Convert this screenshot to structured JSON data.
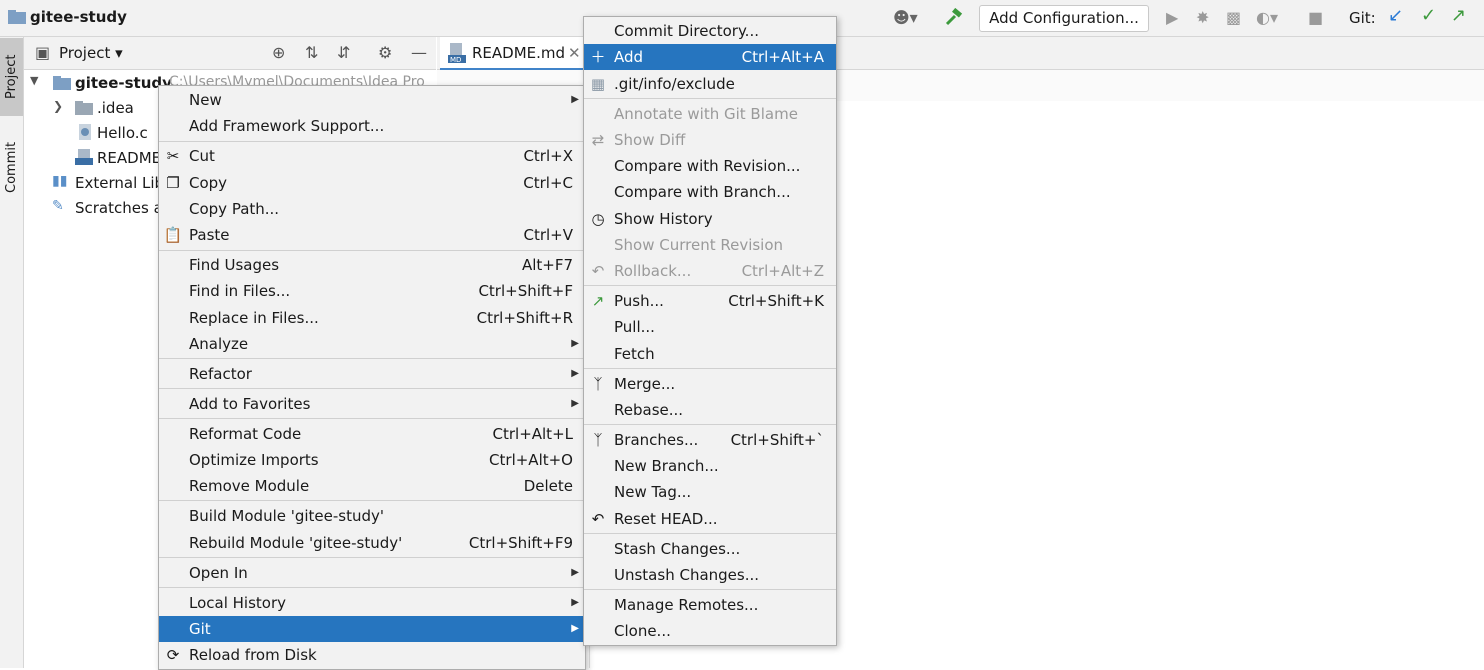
{
  "titlebar": {
    "project_name": "gitee-study",
    "git_label": "Git:",
    "add_configuration": "Add Configuration..."
  },
  "sidebar": {
    "project_tab": "Project",
    "commit_tab": "Commit"
  },
  "project_panel": {
    "header": "Project",
    "root": "gitee-study",
    "root_path": "C:\\Users\\Mymel\\Documents\\Idea Pro",
    "items": [
      ".idea",
      "Hello.c",
      "README",
      "External Lib",
      "Scratches a"
    ]
  },
  "editor": {
    "tab_label": "README.md"
  },
  "context_menu": {
    "items": [
      {
        "label": "New",
        "shortcut": "",
        "submenu": true
      },
      {
        "label": "Add Framework Support...",
        "shortcut": ""
      },
      {
        "label": "Cut",
        "shortcut": "Ctrl+X",
        "icon": "scissors-icon"
      },
      {
        "label": "Copy",
        "shortcut": "Ctrl+C",
        "icon": "copy-icon"
      },
      {
        "label": "Copy Path...",
        "shortcut": ""
      },
      {
        "label": "Paste",
        "shortcut": "Ctrl+V",
        "icon": "clipboard-icon"
      },
      {
        "label": "Find Usages",
        "shortcut": "Alt+F7"
      },
      {
        "label": "Find in Files...",
        "shortcut": "Ctrl+Shift+F"
      },
      {
        "label": "Replace in Files...",
        "shortcut": "Ctrl+Shift+R"
      },
      {
        "label": "Analyze",
        "shortcut": "",
        "submenu": true
      },
      {
        "label": "Refactor",
        "shortcut": "",
        "submenu": true
      },
      {
        "label": "Add to Favorites",
        "shortcut": "",
        "submenu": true
      },
      {
        "label": "Reformat Code",
        "shortcut": "Ctrl+Alt+L"
      },
      {
        "label": "Optimize Imports",
        "shortcut": "Ctrl+Alt+O"
      },
      {
        "label": "Remove Module",
        "shortcut": "Delete"
      },
      {
        "label": "Build Module 'gitee-study'",
        "shortcut": ""
      },
      {
        "label": "Rebuild Module 'gitee-study'",
        "shortcut": "Ctrl+Shift+F9"
      },
      {
        "label": "Open In",
        "shortcut": "",
        "submenu": true
      },
      {
        "label": "Local History",
        "shortcut": "",
        "submenu": true
      },
      {
        "label": "Git",
        "shortcut": "",
        "submenu": true,
        "selected": true
      },
      {
        "label": "Reload from Disk",
        "shortcut": "",
        "icon": "reload-icon"
      }
    ]
  },
  "git_menu": {
    "items": [
      {
        "label": "Commit Directory...",
        "shortcut": ""
      },
      {
        "label": "Add",
        "shortcut": "Ctrl+Alt+A",
        "icon": "plus-icon",
        "selected": true
      },
      {
        "label": ".git/info/exclude",
        "shortcut": "",
        "icon": "file-exclude-icon"
      },
      {
        "label": "Annotate with Git Blame",
        "shortcut": "",
        "disabled": true
      },
      {
        "label": "Show Diff",
        "shortcut": "",
        "disabled": true,
        "icon": "diff-icon"
      },
      {
        "label": "Compare with Revision...",
        "shortcut": ""
      },
      {
        "label": "Compare with Branch...",
        "shortcut": ""
      },
      {
        "label": "Show History",
        "shortcut": "",
        "icon": "clock-icon"
      },
      {
        "label": "Show Current Revision",
        "shortcut": "",
        "disabled": true
      },
      {
        "label": "Rollback...",
        "shortcut": "Ctrl+Alt+Z",
        "disabled": true,
        "icon": "undo-icon"
      },
      {
        "label": "Push...",
        "shortcut": "Ctrl+Shift+K",
        "icon": "push-arrow-icon"
      },
      {
        "label": "Pull...",
        "shortcut": ""
      },
      {
        "label": "Fetch",
        "shortcut": ""
      },
      {
        "label": "Merge...",
        "shortcut": "",
        "icon": "merge-icon"
      },
      {
        "label": "Rebase...",
        "shortcut": ""
      },
      {
        "label": "Branches...",
        "shortcut": "Ctrl+Shift+`",
        "icon": "branch-icon"
      },
      {
        "label": "New Branch...",
        "shortcut": ""
      },
      {
        "label": "New Tag...",
        "shortcut": ""
      },
      {
        "label": "Reset HEAD...",
        "shortcut": "",
        "icon": "reset-icon"
      },
      {
        "label": "Stash Changes...",
        "shortcut": ""
      },
      {
        "label": "Unstash Changes...",
        "shortcut": ""
      },
      {
        "label": "Manage Remotes...",
        "shortcut": ""
      },
      {
        "label": "Clone...",
        "shortcut": ""
      }
    ]
  },
  "colors": {
    "selection": "#2675bf",
    "git_check": "#3d9a3d",
    "git_update": "#2a7ad5"
  }
}
